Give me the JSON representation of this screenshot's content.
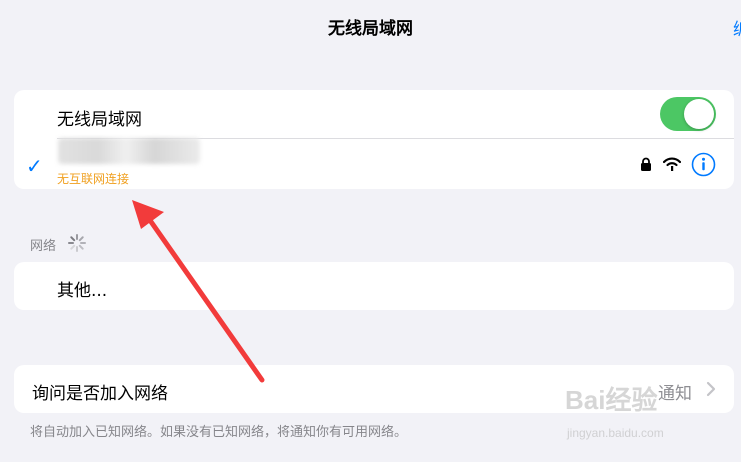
{
  "nav": {
    "title": "无线局域网",
    "edge_text": "编"
  },
  "wifi_card": {
    "toggle_label": "无线局域网",
    "toggle_on": true,
    "connected_status": "无互联网连接",
    "checkmark": "✓"
  },
  "networks_section": {
    "header": "网络",
    "other_label": "其他..."
  },
  "ask_join": {
    "label": "询问是否加入网络",
    "value": "通知",
    "footnote": "将自动加入已知网络。如果没有已知网络，将通知你有可用网络。"
  },
  "watermark": {
    "brand": "Bai经验",
    "url": "jingyan.baidu.com"
  },
  "colors": {
    "accent": "#007aff",
    "toggle_on": "#4cc764",
    "warning": "#f0a020",
    "annotation_arrow": "#f23b3b"
  },
  "icons": [
    "lock-icon",
    "wifi-signal-icon",
    "info-icon",
    "loading-spinner-icon",
    "chevron-right-icon",
    "checkmark-icon"
  ]
}
